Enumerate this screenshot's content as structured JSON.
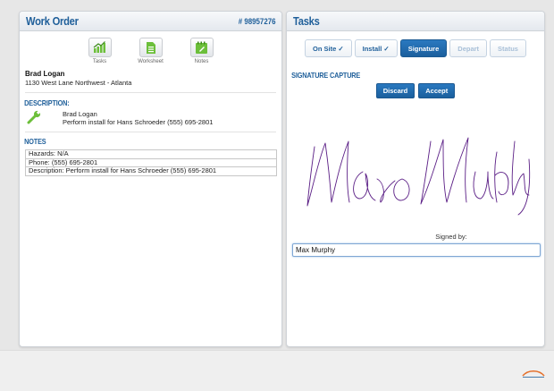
{
  "work_order": {
    "title": "Work Order",
    "number": "# 98957276",
    "actions": [
      {
        "label": "Tasks",
        "icon": "bar-chart-icon"
      },
      {
        "label": "Worksheet",
        "icon": "document-icon"
      },
      {
        "label": "Notes",
        "icon": "notepad-icon"
      }
    ],
    "customer_name": "Brad Logan",
    "customer_address": "1130 West Lane Northwest - Atlanta",
    "description_title": "DESCRIPTION:",
    "description_name": "Brad Logan",
    "description_text": "Perform install for  Hans Schroeder (555) 695-2801",
    "notes_title": "NOTES",
    "notes": [
      "Hazards: N/A",
      "Phone: (555) 695-2801",
      "Description: Perform install for  Hans Schroeder (555) 695-2801"
    ]
  },
  "tasks": {
    "title": "Tasks",
    "tabs": [
      {
        "label": "On Site ✓",
        "state": "done"
      },
      {
        "label": "Install ✓",
        "state": "done"
      },
      {
        "label": "Signature",
        "state": "active"
      },
      {
        "label": "Depart",
        "state": "disabled"
      },
      {
        "label": "Status",
        "state": "disabled"
      }
    ],
    "signature_title": "SIGNATURE CAPTURE",
    "discard_label": "Discard",
    "accept_label": "Accept",
    "signed_by_label": "Signed by:",
    "signer_value": "Max Murphy"
  },
  "colors": {
    "accent": "#1f5f9a",
    "green_icon": "#6cbf3a",
    "signature_ink": "#5b1f86"
  }
}
